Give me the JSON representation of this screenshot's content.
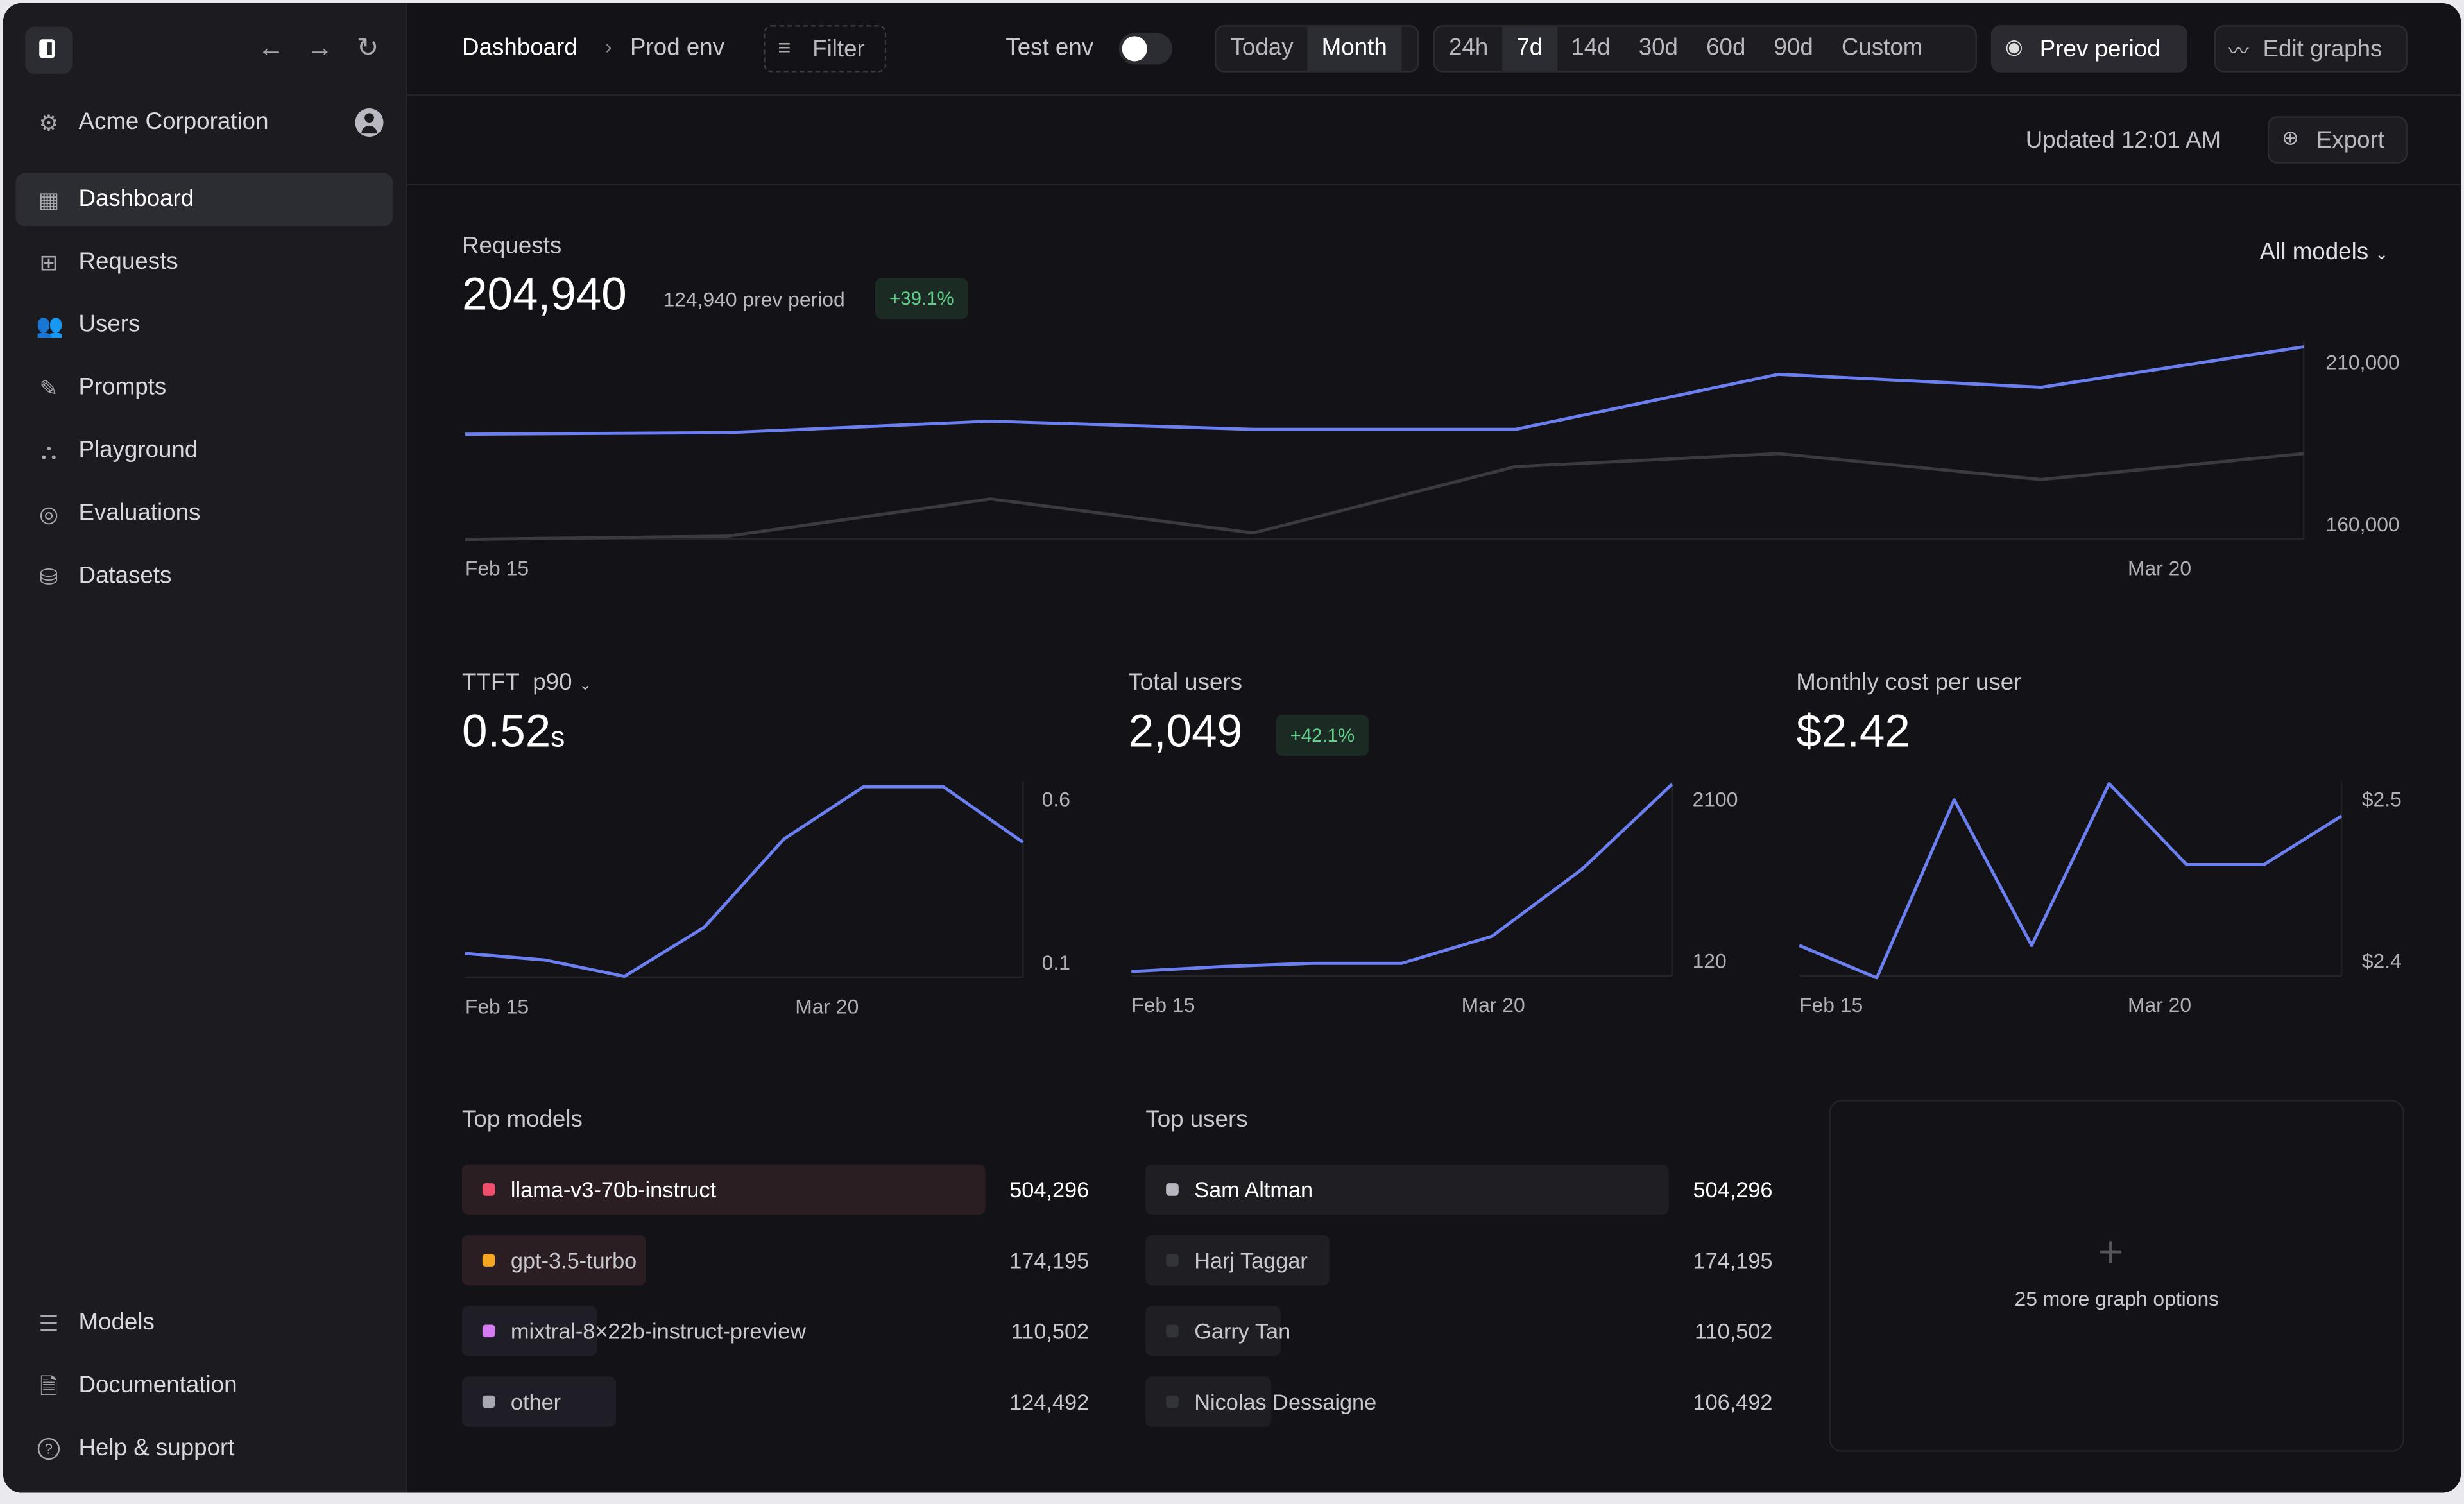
{
  "sidebar": {
    "org": "Acme Corporation",
    "items": [
      {
        "label": "Dashboard",
        "icon": "dashboard-icon",
        "active": true
      },
      {
        "label": "Requests",
        "icon": "table-icon"
      },
      {
        "label": "Users",
        "icon": "users-icon"
      },
      {
        "label": "Prompts",
        "icon": "pencil-icon"
      },
      {
        "label": "Playground",
        "icon": "playground-icon"
      },
      {
        "label": "Evaluations",
        "icon": "target-icon"
      },
      {
        "label": "Datasets",
        "icon": "database-icon"
      }
    ],
    "bottom": [
      {
        "label": "Models",
        "icon": "list-icon"
      },
      {
        "label": "Documentation",
        "icon": "document-icon"
      },
      {
        "label": "Help & support",
        "icon": "help-icon"
      }
    ]
  },
  "header": {
    "breadcrumb": [
      "Dashboard",
      "Prod env"
    ],
    "filter": "Filter",
    "test_env": "Test env",
    "test_env_on": false,
    "range1": [
      "Today",
      "Month"
    ],
    "range1_selected": "Month",
    "range2": [
      "24h",
      "7d",
      "14d",
      "30d",
      "60d",
      "90d",
      "Custom"
    ],
    "range2_selected": "7d",
    "prev_period": "Prev period",
    "edit_graphs": "Edit graphs",
    "updated": "Updated 12:01 AM",
    "export": "Export"
  },
  "requests": {
    "title": "Requests",
    "value": "204,940",
    "prev": "124,940 prev period",
    "change": "+39.1%",
    "model_select": "All models"
  },
  "ttft": {
    "title": "TTFT",
    "metric": "p90",
    "value": "0.52",
    "unit": "s"
  },
  "users": {
    "title": "Total users",
    "value": "2,049",
    "change": "+42.1%"
  },
  "cost": {
    "title": "Monthly cost per user",
    "value": "$2.42"
  },
  "top_models": {
    "title": "Top models",
    "rows": [
      {
        "name": "llama-v3-70b-instruct",
        "value": "504,296",
        "color": "#f0506e",
        "share": 1.0
      },
      {
        "name": "gpt-3.5-turbo",
        "value": "174,195",
        "color": "#f5a623",
        "share": 0.35
      },
      {
        "name": "mixtral-8×22b-instruct-preview",
        "value": "110,502",
        "color": "#d57cf2",
        "share": 0.22
      },
      {
        "name": "other",
        "value": "124,492",
        "color": "#a8a8b0",
        "share": 0.25
      }
    ]
  },
  "top_users": {
    "title": "Top users",
    "rows": [
      {
        "name": "Sam Altman",
        "value": "504,296",
        "share": 1.0
      },
      {
        "name": "Harj Taggar",
        "value": "174,195",
        "share": 0.35
      },
      {
        "name": "Garry Tan",
        "value": "110,502",
        "share": 0.22
      },
      {
        "name": "Nicolas Dessaigne",
        "value": "106,492",
        "share": 0.21
      }
    ]
  },
  "more": {
    "label": "25 more graph options"
  },
  "colors": {
    "accent": "#6b7ff0",
    "prev_line": "#3a3a40",
    "bg": "#131317",
    "sidebar": "#1b1b20"
  },
  "chart_data": [
    {
      "type": "line",
      "x_ticks": [
        "Feb 15",
        "Mar 20"
      ],
      "y_ticks": [
        "160,000",
        "210,000"
      ],
      "y_tick_values": [
        160000,
        210000
      ],
      "series": [
        {
          "values": [
            188000,
            188500,
            192000,
            189500,
            189500,
            206500,
            202500,
            215000
          ]
        },
        {
          "values": [
            155500,
            156500,
            168000,
            157500,
            178000,
            182000,
            174000,
            182000
          ]
        }
      ]
    },
    {
      "type": "line",
      "x_ticks": [
        "Feb 15",
        "Mar 20"
      ],
      "y_ticks": [
        "0.1",
        "0.6"
      ],
      "y_tick_values": [
        0.1,
        0.6
      ],
      "series": [
        {
          "values": [
            0.13,
            0.11,
            0.06,
            0.21,
            0.48,
            0.64,
            0.64,
            0.47
          ]
        }
      ]
    },
    {
      "type": "line",
      "x_ticks": [
        "Feb 15",
        "Mar 20"
      ],
      "y_ticks": [
        "120",
        "2100"
      ],
      "y_tick_values": [
        120,
        2100
      ],
      "series": [
        {
          "values": [
            0,
            60,
            100,
            100,
            430,
            1250,
            2290
          ]
        }
      ]
    },
    {
      "type": "line",
      "x_ticks": [
        "Feb 15",
        "Mar 20"
      ],
      "y_ticks": [
        "$2.4",
        "$2.5"
      ],
      "y_tick_values": [
        2.4,
        2.5
      ],
      "series": [
        {
          "values": [
            2.41,
            2.39,
            2.5,
            2.41,
            2.51,
            2.46,
            2.46,
            2.49
          ]
        }
      ]
    }
  ]
}
